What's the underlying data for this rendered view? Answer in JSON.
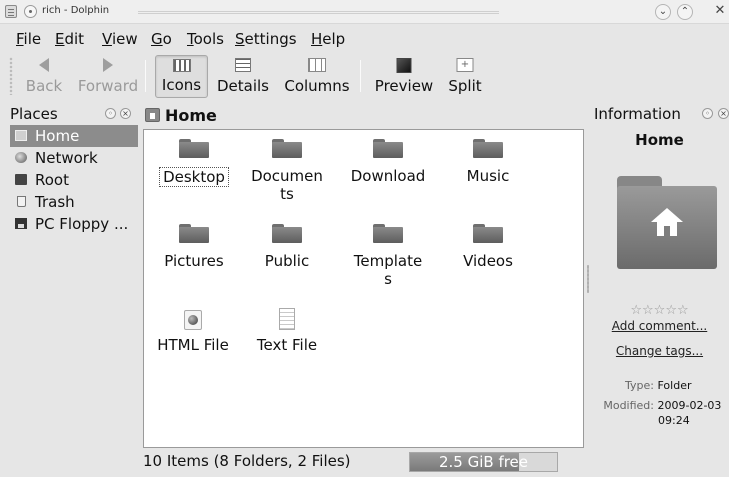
{
  "window": {
    "title": "rich - Dolphin",
    "controls": {
      "minimize_symbol": "⌄",
      "maximize_symbol": "⌃",
      "close_symbol": "✕"
    }
  },
  "menubar": {
    "items": [
      {
        "key": "F",
        "rest": "ile"
      },
      {
        "key": "E",
        "rest": "dit"
      },
      {
        "key": "V",
        "rest": "iew"
      },
      {
        "key": "G",
        "rest": "o"
      },
      {
        "key": "T",
        "rest": "ools"
      },
      {
        "key": "S",
        "rest": "ettings"
      },
      {
        "key": "H",
        "rest": "elp"
      }
    ]
  },
  "toolbar": {
    "back": "Back",
    "forward": "Forward",
    "icons": "Icons",
    "details": "Details",
    "columns": "Columns",
    "preview": "Preview",
    "split": "Split",
    "split_glyph": "+"
  },
  "places": {
    "title": "Places",
    "ctrl_float": "◦",
    "ctrl_close": "×",
    "items": [
      {
        "label": "Home",
        "icon": "home-icon",
        "selected": true
      },
      {
        "label": "Network",
        "icon": "network-icon"
      },
      {
        "label": "Root",
        "icon": "root-drive-icon"
      },
      {
        "label": "Trash",
        "icon": "trash-icon"
      },
      {
        "label": "PC Floppy ...",
        "icon": "floppy-icon"
      }
    ]
  },
  "location": {
    "label": "Home"
  },
  "files": [
    {
      "name": "Desktop",
      "type": "folder"
    },
    {
      "name": "Documen\nts",
      "type": "folder"
    },
    {
      "name": "Download",
      "type": "folder"
    },
    {
      "name": "Music",
      "type": "folder"
    },
    {
      "name": "Pictures",
      "type": "folder"
    },
    {
      "name": "Public",
      "type": "folder"
    },
    {
      "name": "Template\ns",
      "type": "folder"
    },
    {
      "name": "Videos",
      "type": "folder"
    },
    {
      "name": "HTML File",
      "type": "html"
    },
    {
      "name": "Text File",
      "type": "text"
    }
  ],
  "status": {
    "summary": "10 Items (8 Folders, 2 Files)",
    "free_space": "2.5 GiB free",
    "used_fraction": 0.74
  },
  "info": {
    "title": "Information",
    "ctrl_float": "◦",
    "ctrl_close": "×",
    "name": "Home",
    "rating_stars": "☆☆☆☆☆",
    "add_comment": "Add comment...",
    "change_tags": "Change tags...",
    "type_key": "Type:",
    "type_val": "Folder",
    "modified_key": "Modified:",
    "modified_val": "2009-02-03",
    "modified_time": "09:24"
  }
}
